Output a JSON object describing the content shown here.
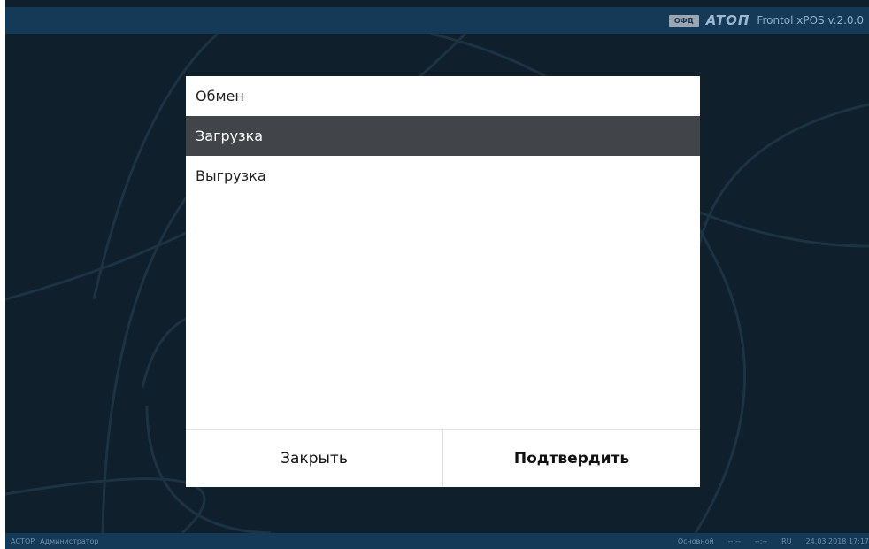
{
  "header": {
    "badge": "ОФД",
    "logo": "ATOΠ",
    "product": "Frontol xPOS v.2.0.0"
  },
  "dialog": {
    "title": "Обмен",
    "items": [
      {
        "label": "Загрузка",
        "selected": true
      },
      {
        "label": "Выгрузка",
        "selected": false
      }
    ],
    "close_label": "Закрыть",
    "confirm_label": "Подтвердить"
  },
  "statusbar": {
    "user_company": "АСТОР",
    "user_role": "Администратор",
    "mode": "Основной",
    "indicator1": "--:--",
    "indicator2": "--:--",
    "language": "RU",
    "datetime": "24.03.2018 17:17"
  },
  "colors": {
    "background": "#0f1f2c",
    "bar": "#153a57",
    "selected_item": "#414549"
  }
}
